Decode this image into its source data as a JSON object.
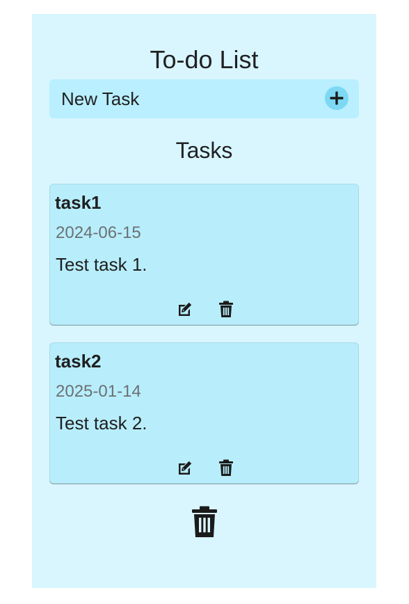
{
  "app": {
    "title": "To-do List"
  },
  "new_task": {
    "label": "New Task",
    "add_icon": "plus-circle-icon"
  },
  "tasks_section": {
    "title": "Tasks"
  },
  "tasks": [
    {
      "name": "task1",
      "date": "2024-06-15",
      "description": "Test task 1.",
      "edit_icon": "edit-icon",
      "delete_icon": "trash-icon"
    },
    {
      "name": "task2",
      "date": "2025-01-14",
      "description": "Test task 2.",
      "edit_icon": "edit-icon",
      "delete_icon": "trash-icon"
    }
  ],
  "footer": {
    "clear_all_icon": "trash-icon"
  },
  "colors": {
    "app_background": "#d9f6ff",
    "card_background": "#b8eefc",
    "input_background": "#b9efff",
    "add_button_background": "#7dd8f3",
    "date_text": "#6c7073",
    "text": "#1f1f1f"
  }
}
